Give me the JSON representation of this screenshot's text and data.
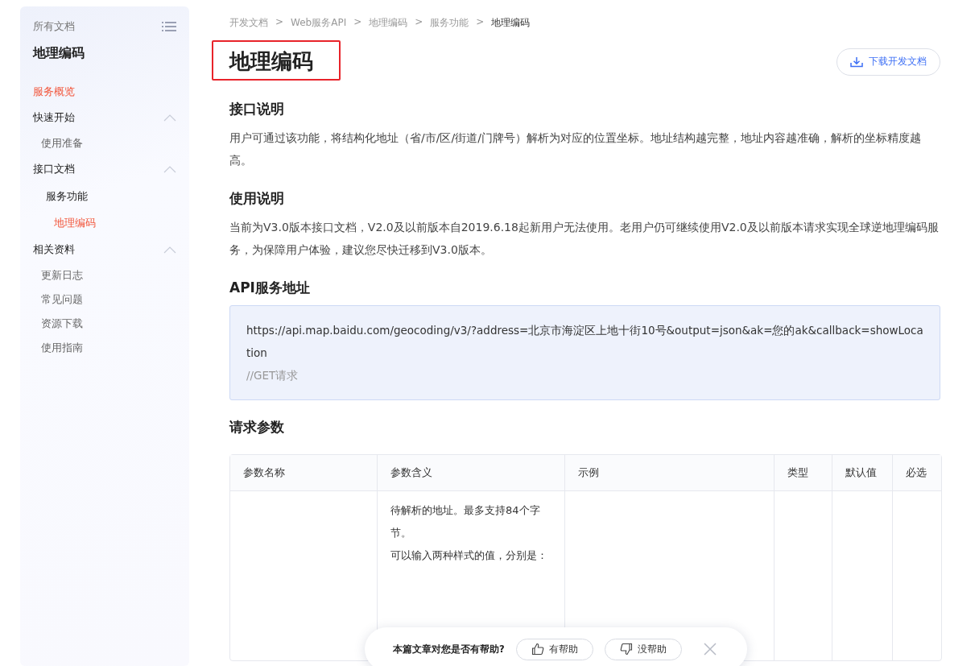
{
  "sidebar": {
    "header": "所有文档",
    "title": "地理编码",
    "items": [
      {
        "label": "服务概览",
        "selected": true,
        "kind": "link"
      },
      {
        "label": "快速开始",
        "kind": "group",
        "expanded": true,
        "children": [
          {
            "label": "使用准备",
            "selected": false,
            "kind": "link"
          }
        ]
      },
      {
        "label": "接口文档",
        "kind": "group",
        "expanded": true,
        "children": [
          {
            "label": "服务功能",
            "kind": "subgroup",
            "children": [
              {
                "label": "地理编码",
                "selected": true,
                "kind": "link"
              }
            ]
          }
        ]
      },
      {
        "label": "相关资料",
        "kind": "group",
        "expanded": true,
        "children": [
          {
            "label": "更新日志",
            "selected": false,
            "kind": "link"
          },
          {
            "label": "常见问题",
            "selected": false,
            "kind": "link"
          },
          {
            "label": "资源下载",
            "selected": false,
            "kind": "link"
          },
          {
            "label": "使用指南",
            "selected": false,
            "kind": "link"
          }
        ]
      }
    ]
  },
  "breadcrumb": [
    "开发文档",
    "Web服务API",
    "地理编码",
    "服务功能",
    "地理编码"
  ],
  "breadcrumb_separator": ">",
  "title": "地理编码",
  "title_highlighted": true,
  "download_button": "下载开发文档",
  "sections": [
    {
      "heading": "接口说明",
      "kind": "text",
      "text": "用户可通过该功能，将结构化地址（省/市/区/街道/门牌号）解析为对应的位置坐标。地址结构越完整，地址内容越准确，解析的坐标精度越高。"
    },
    {
      "heading": "使用说明",
      "kind": "text",
      "text": "当前为V3.0版本接口文档，V2.0及以前版本自2019.6.18起新用户无法使用。老用户仍可继续使用V2.0及以前版本请求实现全球逆地理编码服务，为保障用户体验，建议您尽快迁移到V3.0版本。"
    },
    {
      "heading": "API服务地址",
      "kind": "code",
      "url": "https://api.map.baidu.com/geocoding/v3/?address=北京市海淀区上地十街10号&output=json&ak=您的ak&callback=showLocation",
      "comment": "//GET请求"
    },
    {
      "heading": "请求参数",
      "kind": "table",
      "columns": [
        "参数名称",
        "参数含义",
        "示例",
        "类型",
        "默认值",
        "必选"
      ],
      "rows": [
        [
          "",
          [
            "待解析的地址。最多支持84个字节。",
            "可以输入两种样式的值，分别是："
          ],
          "",
          "",
          "",
          ""
        ]
      ]
    }
  ],
  "feedback": {
    "question": "本篇文章对您是否有帮助?",
    "yes": "有帮助",
    "no": "没帮助"
  }
}
